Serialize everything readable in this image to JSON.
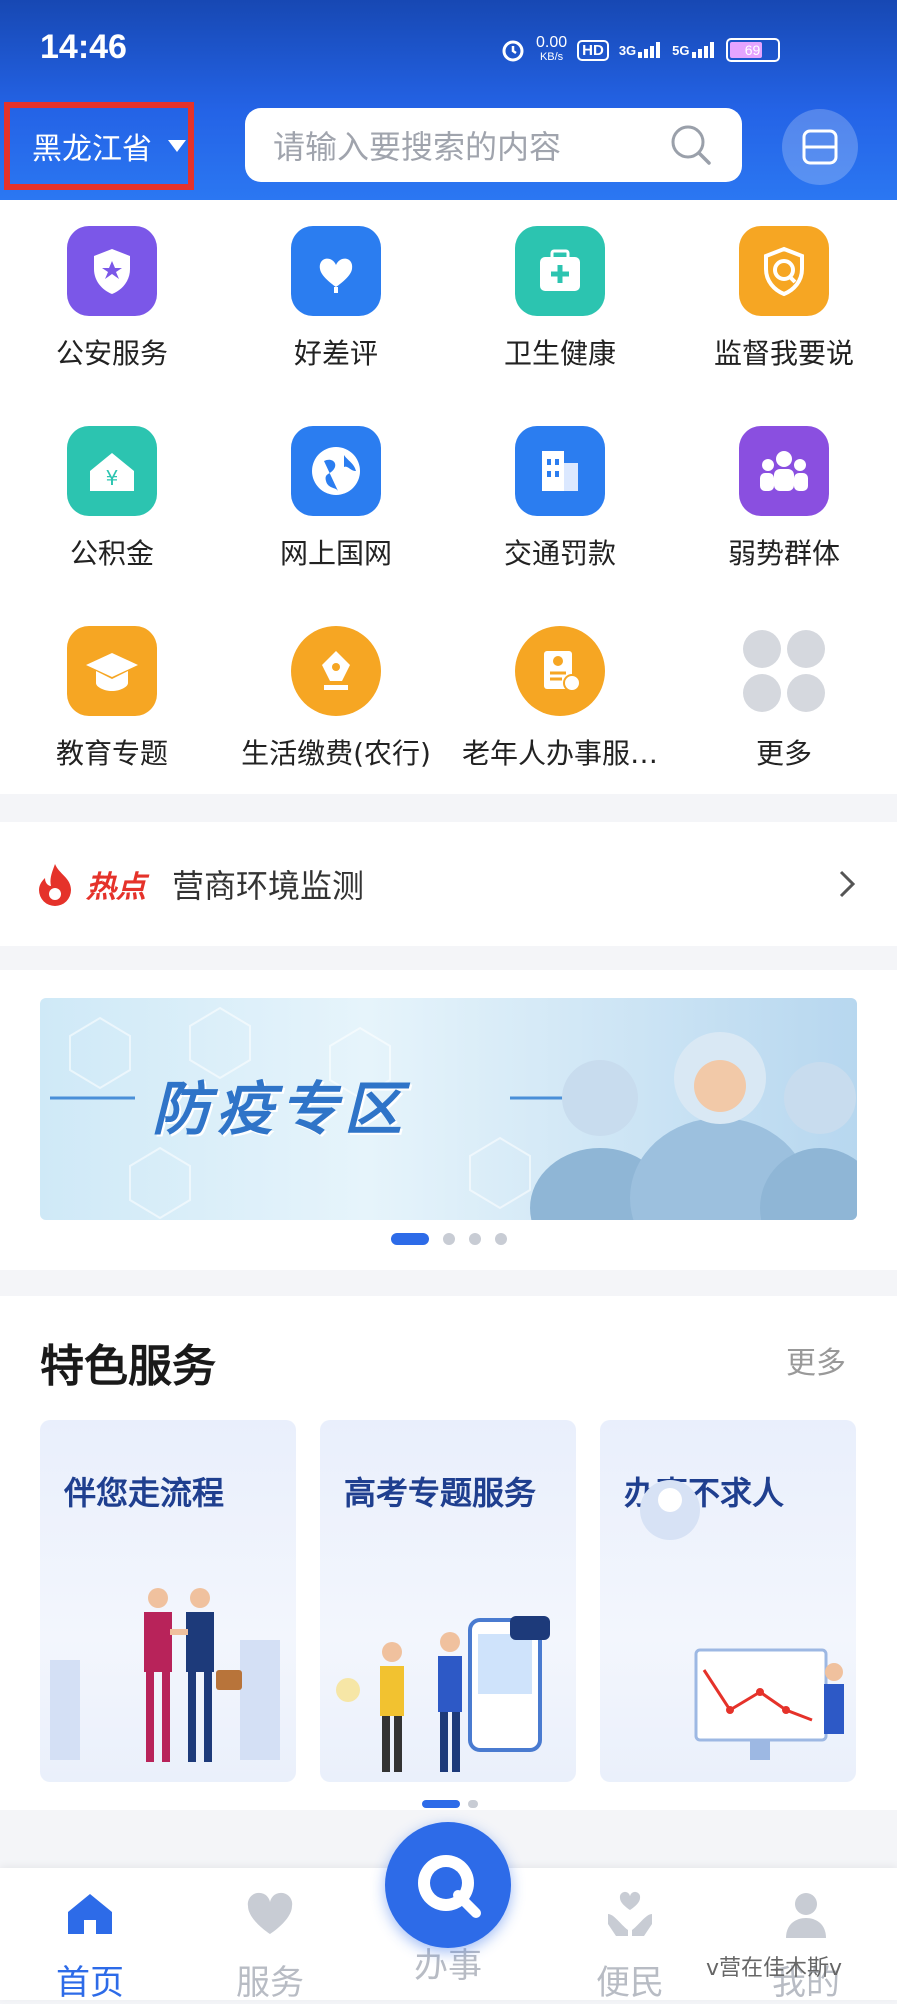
{
  "status_bar": {
    "time": "14:46",
    "net_speed": "0.00",
    "net_unit": "KB/s",
    "hd": "HD",
    "sim1": "3G",
    "sim2": "5G",
    "battery": "69"
  },
  "header": {
    "province": "黑龙江省",
    "search_placeholder": "请输入要搜索的内容"
  },
  "services": [
    {
      "label": "公安服务",
      "icon": "police-shield-icon",
      "color": "#7b57e8"
    },
    {
      "label": "好差评",
      "icon": "heart-flower-icon",
      "color": "#2b7df0"
    },
    {
      "label": "卫生健康",
      "icon": "medical-kit-icon",
      "color": "#2cc4b0"
    },
    {
      "label": "监督我要说",
      "icon": "supervision-shield-icon",
      "color": "#f6a623"
    },
    {
      "label": "公积金",
      "icon": "housing-fund-icon",
      "color": "#2cc4b0"
    },
    {
      "label": "网上国网",
      "icon": "globe-icon",
      "color": "#2b7df0"
    },
    {
      "label": "交通罚款",
      "icon": "building-icon",
      "color": "#2b7df0"
    },
    {
      "label": "弱势群体",
      "icon": "people-icon",
      "color": "#8a4fe0"
    },
    {
      "label": "教育专题",
      "icon": "graduation-cap-icon",
      "color": "#f6a623"
    },
    {
      "label": "生活缴费(农行)",
      "icon": "pen-nib-icon",
      "color": "#f6a623"
    },
    {
      "label": "老年人办事服…",
      "icon": "elderly-id-icon",
      "color": "#f6a623"
    },
    {
      "label": "更多",
      "icon": "more-grid-icon",
      "color": "#c8ccd4"
    }
  ],
  "hot": {
    "tag": "热点",
    "text": "营商环境监测"
  },
  "banner": {
    "title": "防疫专区"
  },
  "featured": {
    "title": "特色服务",
    "more": "更多",
    "cards": [
      {
        "title": "伴您走流程"
      },
      {
        "title": "高考专题服务"
      },
      {
        "title": "办事不求人"
      }
    ]
  },
  "nav": {
    "home": "首页",
    "service": "服务",
    "center": "办事",
    "convenience": "便民",
    "mine": "我的"
  },
  "watermark": "v营在佳木斯v"
}
